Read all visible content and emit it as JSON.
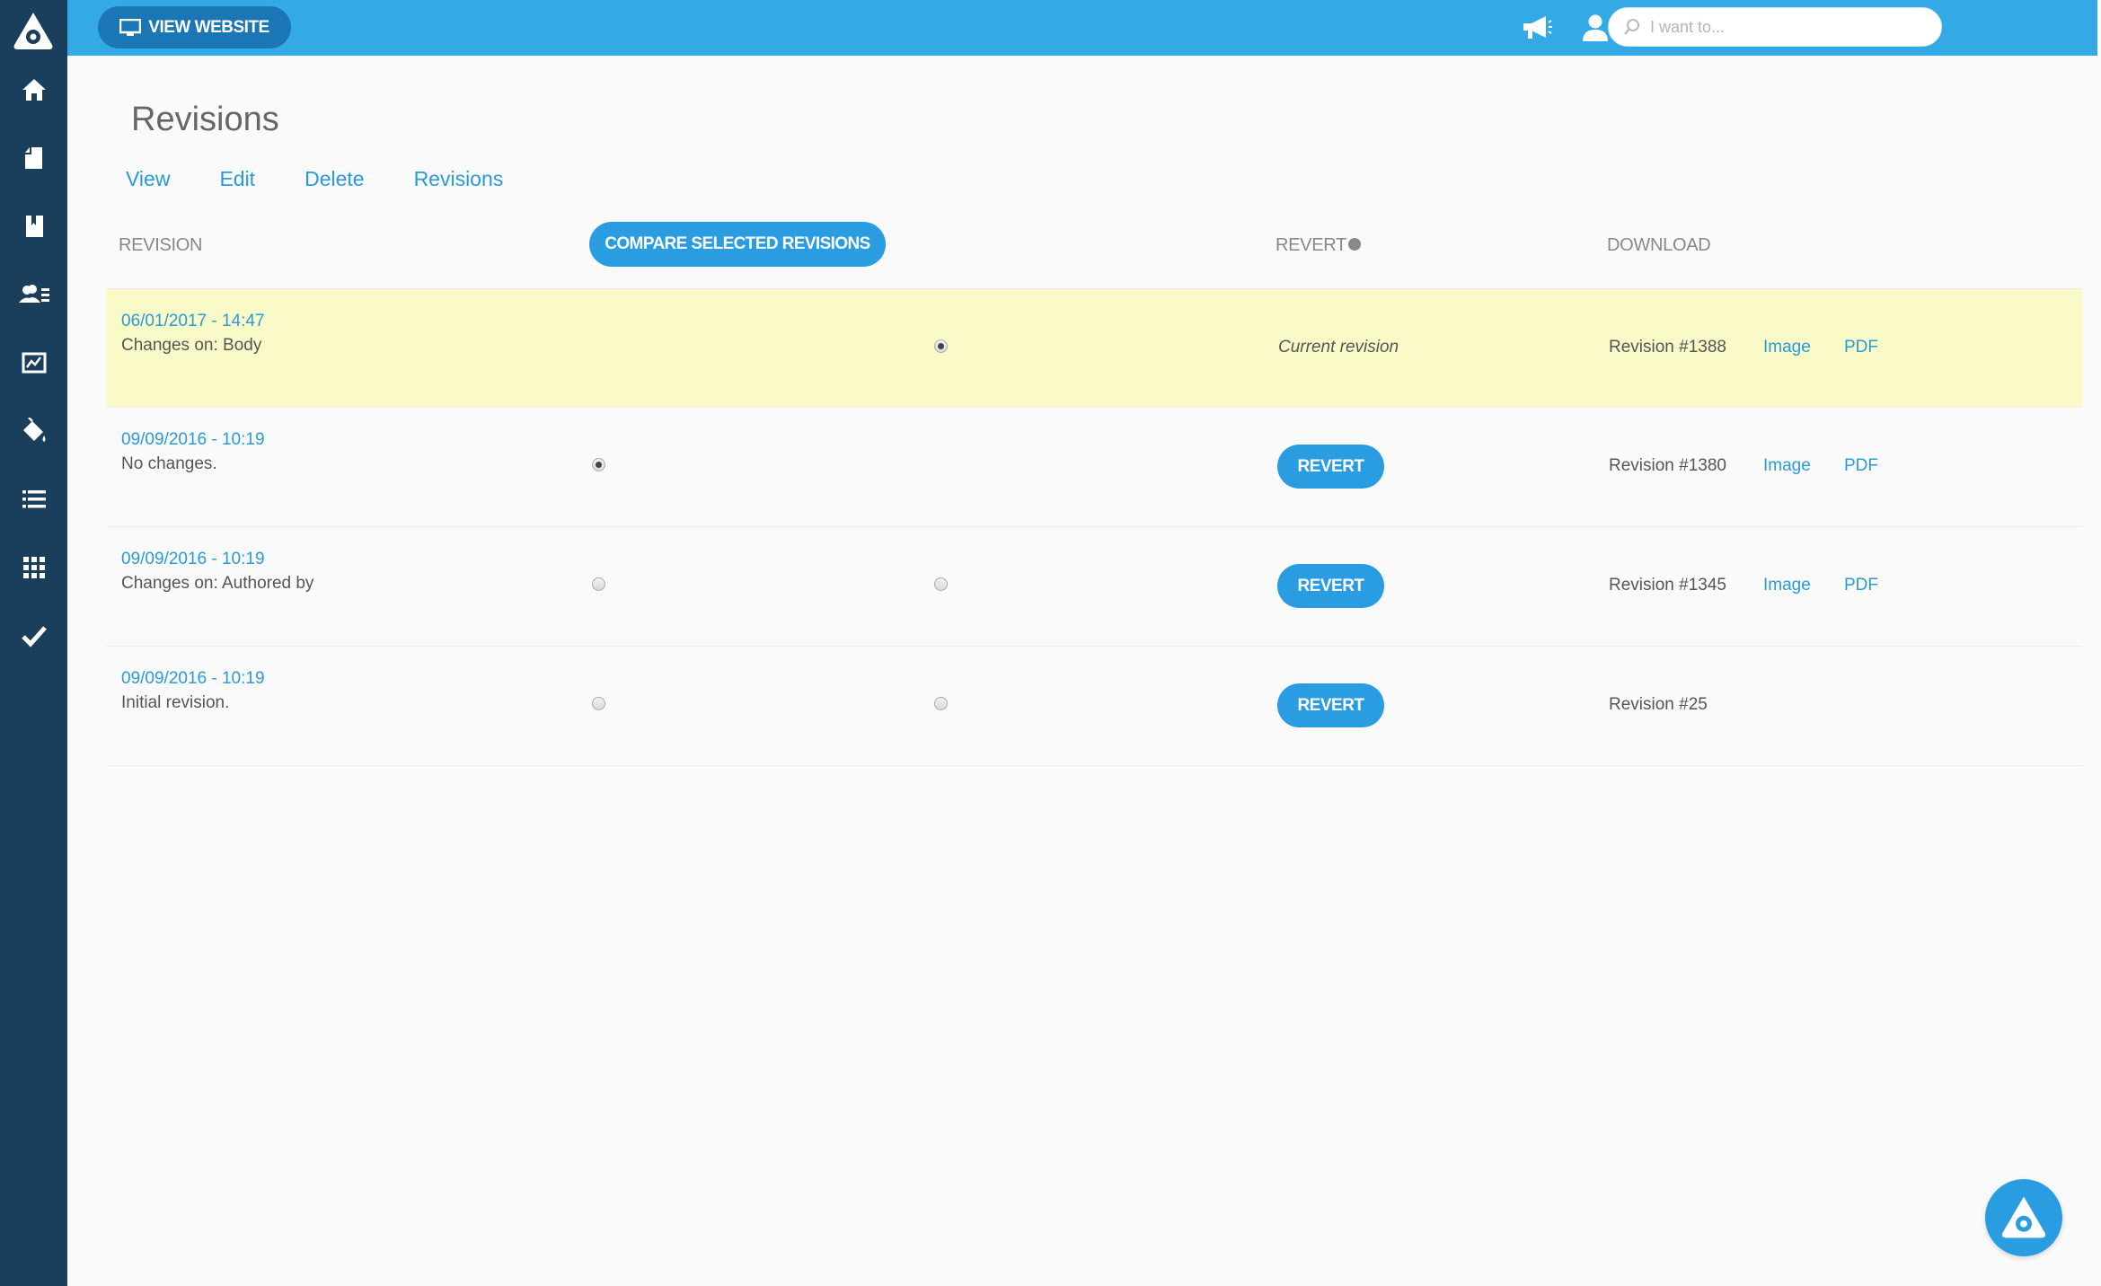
{
  "header": {
    "view_website_label": "VIEW WEBSITE",
    "search_placeholder": "I want to..."
  },
  "sidebar": {
    "items": [
      "home-icon",
      "pages-icon",
      "book-icon",
      "users-icon",
      "analytics-icon",
      "paint-bucket-icon",
      "list-icon",
      "apps-grid-icon",
      "checkmark-icon"
    ]
  },
  "page": {
    "title": "Revisions",
    "tabs": [
      "View",
      "Edit",
      "Delete",
      "Revisions"
    ]
  },
  "table": {
    "headers": {
      "revision": "REVISION",
      "compare": "COMPARE SELECTED REVISIONS",
      "revert": "REVERT",
      "download": "DOWNLOAD"
    },
    "rows": [
      {
        "date": "06/01/2017 - 14:47",
        "description": "Changes on: Body",
        "left_radio": null,
        "right_radio": "checked",
        "revert": "Current revision",
        "revision": "Revision #1388",
        "image": "Image",
        "pdf": "PDF"
      },
      {
        "date": "09/09/2016 - 10:19",
        "description": "No changes.",
        "left_radio": "checked",
        "right_radio": null,
        "revert": "REVERT",
        "revision": "Revision #1380",
        "image": "Image",
        "pdf": "PDF"
      },
      {
        "date": "09/09/2016 - 10:19",
        "description": "Changes on: Authored by",
        "left_radio": "unchecked",
        "right_radio": "unchecked",
        "revert": "REVERT",
        "revision": "Revision #1345",
        "image": "Image",
        "pdf": "PDF"
      },
      {
        "date": "09/09/2016 - 10:19",
        "description": "Initial revision.",
        "left_radio": "unchecked",
        "right_radio": "unchecked",
        "revert": "REVERT",
        "revision": "Revision #25",
        "image": null,
        "pdf": null
      }
    ]
  },
  "colors": {
    "sidebar": "#1a3f5c",
    "topbar": "#33a9e6",
    "accent": "#2a9de2",
    "current_row": "#fafac8"
  }
}
